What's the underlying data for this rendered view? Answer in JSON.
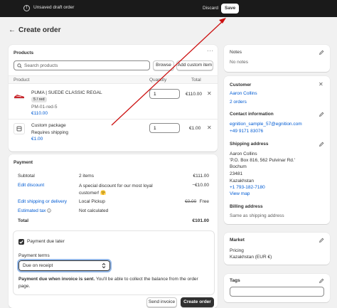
{
  "topbar": {
    "alert_icon": "alert-circle-icon",
    "message": "Unsaved draft order",
    "discard_label": "Discard",
    "save_label": "Save"
  },
  "header": {
    "back_icon": "arrow-left-icon",
    "back_glyph": "←",
    "title": "Create order"
  },
  "products": {
    "heading": "Products",
    "menu_glyph": "···",
    "search_placeholder": "Search products",
    "browse_label": "Browse",
    "add_custom_label": "Add custom item",
    "columns": [
      "Product",
      "Quantity",
      "Total"
    ],
    "items": [
      {
        "name": "PUMA | SUEDE CLASSIC REGAL",
        "variant": "5 / red",
        "sku": "PM-01-red-5",
        "price": "€110.00",
        "quantity": "1",
        "total": "€110.00",
        "remove_glyph": "✕",
        "thumb_icon": "sneaker-image"
      },
      {
        "name": "Custom package",
        "note": "Requires shipping",
        "price": "€1.00",
        "quantity": "1",
        "total": "€1.00",
        "remove_glyph": "✕",
        "thumb_icon": "package-icon"
      }
    ]
  },
  "payment": {
    "heading": "Payment",
    "rows": [
      {
        "label": "Subtotal",
        "middle": "2 items",
        "value": "€111.00"
      },
      {
        "label": "Edit discount",
        "middle": "A special discount for our most loyal customer! 🤗",
        "value": "−€10.00"
      },
      {
        "label": "Edit shipping or delivery",
        "middle": "Local Pickup",
        "value_struck": "€0.00",
        "value": "Free"
      },
      {
        "label": "Estimated tax",
        "middle": "Not calculated",
        "value": ""
      },
      {
        "label": "Total",
        "middle": "",
        "value": "€101.00"
      }
    ],
    "info_icon": "info-icon",
    "payment_due_later_label": "Payment due later",
    "payment_terms_label": "Payment terms",
    "payment_terms_value": "Due on receipt",
    "select_icon": "chevron-up-down-icon",
    "select_glyph": "⌃⌄",
    "notice_bold": "Payment due when invoice is sent.",
    "notice_rest": " You'll be able to collect the balance from the order page.",
    "send_invoice_label": "Send invoice",
    "create_order_label": "Create order"
  },
  "notes": {
    "heading": "Notes",
    "empty": "No notes",
    "edit_icon": "pencil-icon"
  },
  "customer": {
    "heading": "Customer",
    "close_glyph": "✕",
    "name": "Aaron Collins",
    "orders": "2 orders",
    "contact_heading": "Contact information",
    "email": "egnition_sample_57@egnition.com",
    "phone": "+49 9171 83076",
    "shipping_heading": "Shipping address",
    "address": [
      "Aaron Collins",
      "'P.O. Box 816, 562 Pulvinar Rd.'",
      "Bochum",
      "23481",
      "Kazakhstan"
    ],
    "address_phone": "+1 793-182-7180",
    "view_map": "View map",
    "billing_heading": "Billing address",
    "billing_value": "Same as shipping address"
  },
  "market": {
    "heading": "Market",
    "pricing_label": "Pricing",
    "pricing_value": "Kazakhstan (EUR €)"
  },
  "tags": {
    "heading": "Tags"
  },
  "colors": {
    "topbar": "#1a1a1a",
    "link": "#005bd3",
    "annotation_arrow": "#cc1111",
    "primary_button": "#303030"
  }
}
